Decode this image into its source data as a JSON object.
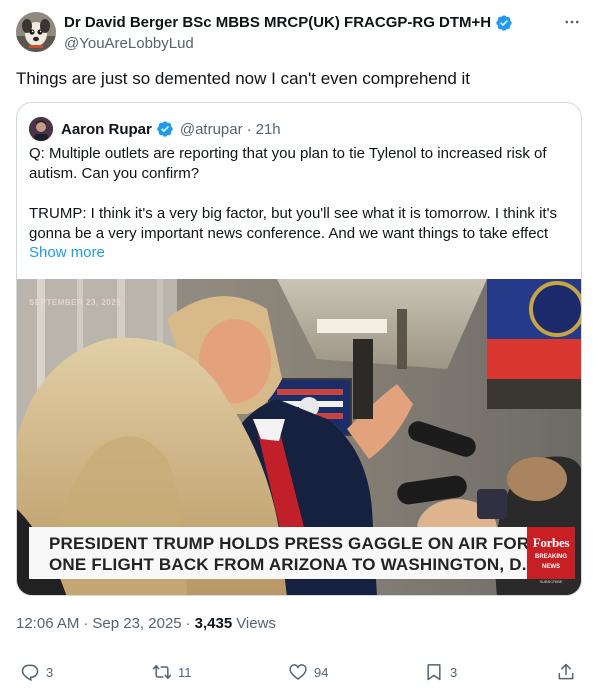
{
  "tweet": {
    "author": {
      "display_name": "Dr David Berger BSc MBBS MRCP(UK) FRACGP-RG DTM+H",
      "handle": "@YouAreLobbyLud",
      "verified": true,
      "avatar_icon": "dog-avatar"
    },
    "more_icon": "more-horizontal-icon",
    "text": "Things are just so demented now I can't even comprehend it",
    "quote": {
      "author": {
        "display_name": "Aaron Rupar",
        "handle": "@atrupar",
        "separator": "·",
        "time": "21h",
        "verified": true
      },
      "paragraphs": [
        "Q: Multiple outlets are reporting that you plan to tie Tylenol to increased risk of autism. Can you confirm?",
        "TRUMP: I think it's a very big factor, but you'll see what it is tomorrow. I think it's gonna be a very important news conference. And we want things to take effect"
      ],
      "show_more": "Show more",
      "video": {
        "date_stamp": "SEPTEMBER 23, 2025",
        "lower_third_line1": "PRESIDENT TRUMP HOLDS PRESS GAGGLE ON AIR FORCE",
        "lower_third_line2": "ONE FLIGHT BACK FROM ARIZONA TO WASHINGTON, D.C.\\",
        "network_logo": "Forbes",
        "network_sub1": "BREAKING",
        "network_sub2": "NEWS",
        "network_tag": "SUBSCRIBE"
      }
    },
    "meta": {
      "time": "12:06 AM",
      "dot1": "·",
      "date": "Sep 23, 2025",
      "dot2": "·",
      "views_count": "3,435",
      "views_label": "Views"
    },
    "actions": {
      "replies": "3",
      "reposts": "11",
      "likes": "94",
      "bookmarks": "3"
    },
    "colors": {
      "accent": "#1d9bf0",
      "secondary_text": "#536471",
      "border": "#cfd9de",
      "forbes_red": "#c81f25"
    }
  }
}
